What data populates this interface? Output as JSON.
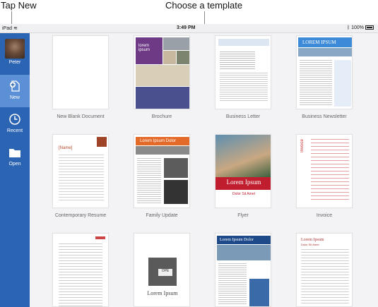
{
  "callouts": {
    "tap_new": "Tap New",
    "choose_template": "Choose a template"
  },
  "statusbar": {
    "device": "iPad",
    "time": "3:49 PM",
    "battery": "100%",
    "wifi_icon": "wifi-icon",
    "bluetooth_icon": "bluetooth-icon"
  },
  "sidebar": {
    "user": "Peter",
    "items": [
      {
        "label": "New",
        "icon": "new-document-icon"
      },
      {
        "label": "Recent",
        "icon": "clock-icon"
      },
      {
        "label": "Open",
        "icon": "folder-icon"
      }
    ]
  },
  "templates": [
    {
      "name": "New Blank Document"
    },
    {
      "name": "Brochure"
    },
    {
      "name": "Business Letter"
    },
    {
      "name": "Business Newsletter"
    },
    {
      "name": "Contemporary Resume"
    },
    {
      "name": "Family Update"
    },
    {
      "name": "Flyer"
    },
    {
      "name": "Invoice"
    }
  ],
  "thumbs": {
    "brochure_text": "lorem\nipsum",
    "newsletter_title": "LOREM IPSUM",
    "resume_name": "[Name]",
    "family_title": "Lorem Ipsum Dolor",
    "flyer_title": "Lorem Ipsum",
    "flyer_sub": "Dolor Sit Amet",
    "invoice_title": "Invoice",
    "row3_photo_text": "OPE",
    "row3_title": "Lorem Ipsum",
    "row3_news_title": "Lorem Ipsum Dolor",
    "row3_resume_name": "Lorem Ipsum",
    "row3_resume_sub": "Dolor Sit Amet"
  }
}
